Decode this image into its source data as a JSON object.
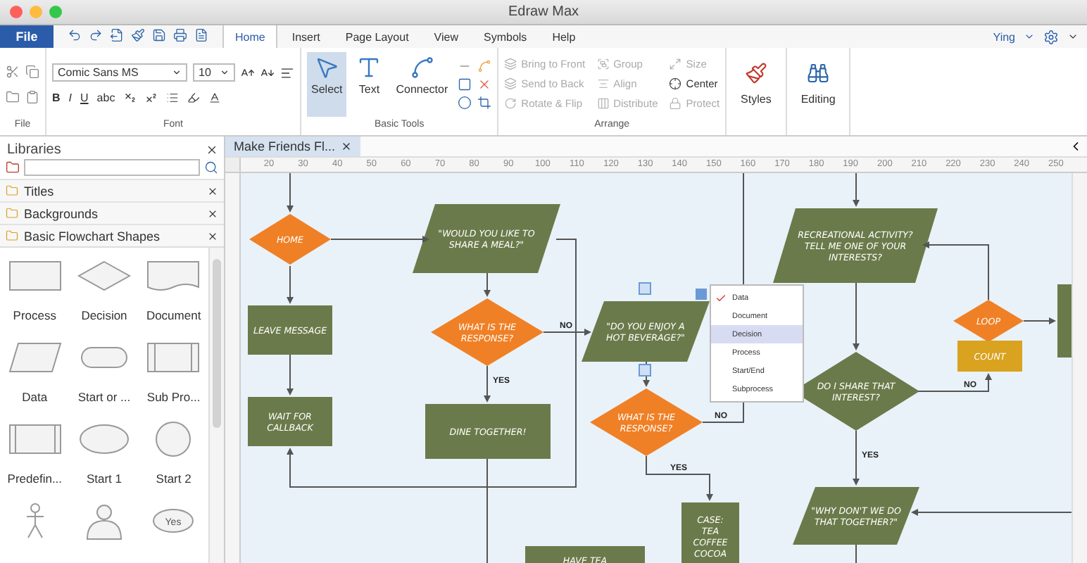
{
  "window": {
    "title": "Edraw Max"
  },
  "menu": {
    "file_button": "File",
    "tabs": [
      {
        "label": "Home",
        "selected": true
      },
      {
        "label": "Insert",
        "selected": false
      },
      {
        "label": "Page Layout",
        "selected": false
      },
      {
        "label": "View",
        "selected": false
      },
      {
        "label": "Symbols",
        "selected": false
      },
      {
        "label": "Help",
        "selected": false
      }
    ],
    "user": "Ying"
  },
  "ribbon": {
    "file_group": {
      "label": "File"
    },
    "font_group": {
      "label": "Font",
      "font_name": "Comic Sans MS",
      "font_size": "10",
      "format_buttons": [
        "B",
        "I",
        "U",
        "abc"
      ]
    },
    "basic_tools": {
      "label": "Basic Tools",
      "tools": [
        {
          "kind": "select",
          "label": "Select",
          "selected": true
        },
        {
          "kind": "text",
          "label": "Text",
          "selected": false
        },
        {
          "kind": "connector",
          "label": "Connector",
          "selected": false
        }
      ]
    },
    "arrange": {
      "label": "Arrange",
      "items": [
        {
          "kind": "front",
          "label": "Bring to Front",
          "disabled": true
        },
        {
          "kind": "group",
          "label": "Group",
          "disabled": true
        },
        {
          "kind": "size",
          "label": "Size",
          "disabled": true
        },
        {
          "kind": "back",
          "label": "Send to Back",
          "disabled": true
        },
        {
          "kind": "align",
          "label": "Align",
          "disabled": true
        },
        {
          "kind": "center",
          "label": "Center",
          "disabled": false
        },
        {
          "kind": "rotate",
          "label": "Rotate & Flip",
          "disabled": true
        },
        {
          "kind": "distribute",
          "label": "Distribute",
          "disabled": true
        },
        {
          "kind": "protect",
          "label": "Protect",
          "disabled": true
        }
      ]
    },
    "styles": {
      "label": "Styles"
    },
    "editing": {
      "label": "Editing"
    }
  },
  "libraries": {
    "title": "Libraries",
    "categories": [
      {
        "label": "Titles"
      },
      {
        "label": "Backgrounds"
      },
      {
        "label": "Basic Flowchart Shapes"
      }
    ],
    "shapes": [
      {
        "kind": "process",
        "label": "Process"
      },
      {
        "kind": "decision",
        "label": "Decision"
      },
      {
        "kind": "document",
        "label": "Document"
      },
      {
        "kind": "data",
        "label": "Data"
      },
      {
        "kind": "terminator",
        "label": "Start or ..."
      },
      {
        "kind": "subprocess",
        "label": "Sub Pro..."
      },
      {
        "kind": "predefined",
        "label": "Predefin..."
      },
      {
        "kind": "ellipse",
        "label": "Start 1"
      },
      {
        "kind": "circle",
        "label": "Start 2"
      },
      {
        "kind": "person"
      },
      {
        "kind": "user"
      },
      {
        "kind": "oval-text",
        "text": "Yes"
      }
    ]
  },
  "document_tab": {
    "label": "Make Friends Fl..."
  },
  "ruler": {
    "ticks": [
      "20",
      "30",
      "40",
      "50",
      "60",
      "70",
      "80",
      "90",
      "100",
      "110",
      "120",
      "130",
      "140",
      "150",
      "160",
      "170",
      "180",
      "190",
      "200",
      "210",
      "220",
      "230",
      "240",
      "250"
    ]
  },
  "diagram": {
    "nodes": [
      {
        "kind": "decision",
        "color": "#f08026",
        "lines": [
          "HOME"
        ]
      },
      {
        "kind": "process",
        "color": "#6b7a4a",
        "lines": [
          "LEAVE MESSAGE"
        ]
      },
      {
        "kind": "process",
        "color": "#6b7a4a",
        "lines": [
          "WAIT FOR",
          "CALLBACK"
        ]
      },
      {
        "kind": "data",
        "color": "#6b7a4a",
        "lines": [
          "\"WOULD YOU LIKE TO",
          "SHARE A MEAL?\""
        ]
      },
      {
        "kind": "decision",
        "color": "#f08026",
        "lines": [
          "WHAT IS THE",
          "RESPONSE?"
        ]
      },
      {
        "kind": "process",
        "color": "#6b7a4a",
        "lines": [
          "DINE TOGETHER!"
        ]
      },
      {
        "kind": "data",
        "color": "#6b7a4a",
        "lines": [
          "\"DO YOU ENJOY A",
          "HOT BEVERAGE?\""
        ]
      },
      {
        "kind": "decision",
        "color": "#f08026",
        "lines": [
          "WHAT IS THE",
          "RESPONSE?"
        ]
      },
      {
        "kind": "process",
        "color": "#6b7a4a",
        "lines": [
          "CASE:",
          "TEA",
          "COFFEE",
          "COCOA"
        ]
      },
      {
        "kind": "process",
        "color": "#6b7a4a",
        "lines": [
          "HAVE TEA"
        ]
      },
      {
        "kind": "data",
        "color": "#6b7a4a",
        "lines": [
          "RECREATIONAL ACTIVITY?",
          "TELL ME ONE OF YOUR",
          "INTERESTS?"
        ]
      },
      {
        "kind": "decision",
        "color": "#6b7a4a",
        "lines": [
          "DO I SHARE THAT",
          "INTEREST?"
        ]
      },
      {
        "kind": "decision",
        "color": "#f08026",
        "lines": [
          "LOOP"
        ]
      },
      {
        "kind": "process",
        "color": "#d9a21f",
        "lines": [
          "COUNT"
        ]
      },
      {
        "kind": "data",
        "color": "#6b7a4a",
        "lines": [
          "\"WHY DON'T WE DO",
          "THAT TOGETHER?\""
        ]
      },
      {
        "kind": "process",
        "color": "#6b7a4a"
      }
    ],
    "edge_labels": [
      "NO",
      "YES",
      "NO",
      "YES",
      "NO",
      "YES"
    ]
  },
  "shape_menu": {
    "items": [
      {
        "label": "Data",
        "checked": true,
        "highlighted": false
      },
      {
        "label": "Document",
        "checked": false,
        "highlighted": false
      },
      {
        "label": "Decision",
        "checked": false,
        "highlighted": true
      },
      {
        "label": "Process",
        "checked": false,
        "highlighted": false
      },
      {
        "label": "Start/End",
        "checked": false,
        "highlighted": false
      },
      {
        "label": "Subprocess",
        "checked": false,
        "highlighted": false
      }
    ]
  }
}
